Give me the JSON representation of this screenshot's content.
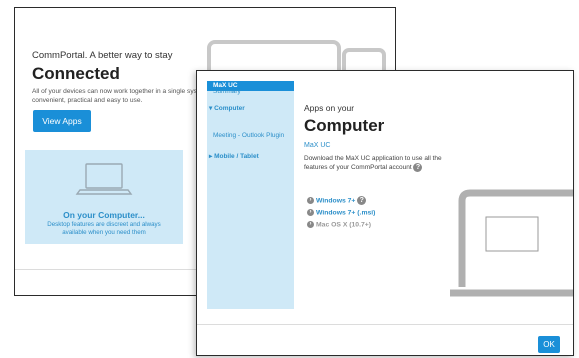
{
  "back_window": {
    "subtitle": "CommPortal. A better way to stay",
    "title": "Connected",
    "body": "All of your devices can now work together in a single system that's convenient, practical and easy to use.",
    "view_apps_button": "View Apps",
    "card": {
      "title": "On your Computer...",
      "text": "Desktop features are discreet and always available when you need them"
    }
  },
  "front_window": {
    "sidebar": {
      "summary": "Summary",
      "computer": "Computer",
      "maxuc": "MaX UC",
      "meeting": "Meeting - Outlook Plugin",
      "mobile": "Mobile / Tablet"
    },
    "kicker": "Apps on your",
    "title": "Computer",
    "app_link": "MaX UC",
    "description": "Download the MaX UC application to use all the features of your CommPortal account",
    "downloads": [
      {
        "label": "Windows 7+"
      },
      {
        "label": "Windows 7+ (.msi)"
      },
      {
        "label": "Mac OS X (10.7+)"
      }
    ],
    "ok_button": "OK"
  },
  "colors": {
    "accent": "#1a8fd8",
    "sidebar_bg": "#cfe9f7",
    "link": "#2c8fc9"
  },
  "icons": [
    "laptop-icon",
    "tablet-icon",
    "help-icon",
    "download-icon",
    "chevron-right-icon",
    "chevron-down-icon"
  ]
}
